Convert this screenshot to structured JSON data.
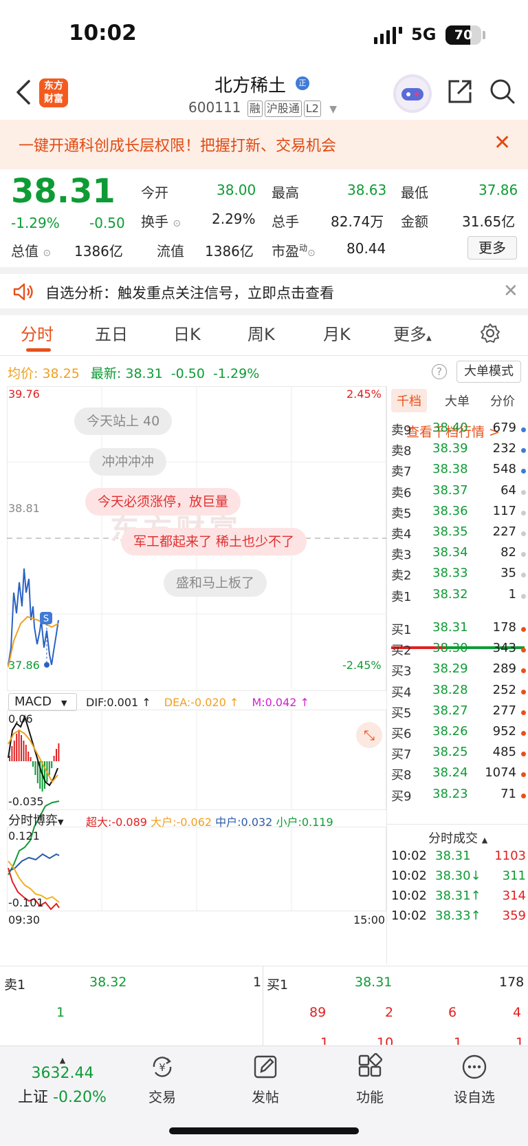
{
  "status": {
    "time": "10:02",
    "network": "5G",
    "battery": "70",
    "battery_level": 0.7
  },
  "header": {
    "logo": [
      "东方",
      "财富"
    ],
    "title": "北方稀土",
    "badge": "正",
    "code": "600111",
    "tags": [
      "融",
      "沪股通",
      "L2"
    ]
  },
  "banner": {
    "text": "一键开通科创成长层权限！把握打新、交易机会"
  },
  "quote": {
    "price": "38.31",
    "change_pct": "-1.29%",
    "change": "-0.50",
    "rows": [
      [
        {
          "label": "今开",
          "value": "38.00",
          "color": "g"
        },
        {
          "label": "最高",
          "value": "38.63",
          "color": "g"
        },
        {
          "label": "最低",
          "value": "37.86",
          "color": "g"
        }
      ],
      [
        {
          "label": "换手",
          "value": "2.29%",
          "color": ""
        },
        {
          "label": "总手",
          "value": "82.74万",
          "color": ""
        },
        {
          "label": "金额",
          "value": "31.65亿",
          "color": ""
        }
      ],
      [
        {
          "label": "流值",
          "value": "1386亿",
          "color": ""
        },
        {
          "label": "市盈",
          "value": "80.44",
          "color": ""
        }
      ]
    ],
    "total_label": "总值",
    "total_value": "1386亿",
    "pe_sup": "动",
    "more": "更多"
  },
  "alert": {
    "text": "自选分析：触发重点关注信号，立即点击查看"
  },
  "tabs": [
    "分时",
    "五日",
    "日K",
    "周K",
    "月K",
    "更多"
  ],
  "avg": {
    "avg_label": "均价:",
    "avg": "38.25",
    "latest_label": "最新:",
    "latest": "38.31",
    "chg": "-0.50",
    "pct": "-1.29%",
    "big_mode": "大单模式"
  },
  "chart": {
    "price_high": "39.76",
    "price_low": "37.86",
    "pct_high": "2.45%",
    "pct_low": "-2.45%",
    "ref": "38.81",
    "bubbles": [
      {
        "text": "今天站上 40",
        "style": "gray"
      },
      {
        "text": "冲冲冲冲",
        "style": "gray"
      },
      {
        "text": "今天必须涨停，放巨量",
        "style": "pink"
      },
      {
        "text": "军工都起来了 稀土也少不了",
        "style": "pink"
      },
      {
        "text": "盛和马上板了",
        "style": "gray"
      }
    ],
    "watermark": "东方财富",
    "macd": {
      "name": "MACD",
      "dif": "DIF:0.001 ↑",
      "dea": "DEA:-0.020 ↑",
      "m": "M:0.042 ↑",
      "top": "0.06",
      "bottom": "-0.035"
    },
    "game": {
      "name": "分时博弈",
      "super": "超大:-0.089",
      "big": "大户:-0.062",
      "mid": "中户:0.032",
      "small": "小户:0.119",
      "top": "0.121",
      "bottom": "-0.101"
    },
    "time_start": "09:30",
    "time_end": "15:00"
  },
  "book": {
    "tabs": [
      "千档",
      "大单",
      "分价"
    ],
    "link": "查看千档行情 >",
    "sells": [
      {
        "label": "卖9",
        "price": "38.40",
        "vol": "679",
        "dot": "#3f7ad8"
      },
      {
        "label": "卖8",
        "price": "38.39",
        "vol": "232",
        "dot": "#3f7ad8"
      },
      {
        "label": "卖7",
        "price": "38.38",
        "vol": "548",
        "dot": "#3f7ad8"
      },
      {
        "label": "卖6",
        "price": "38.37",
        "vol": "64",
        "dot": "#ccc"
      },
      {
        "label": "卖5",
        "price": "38.36",
        "vol": "117",
        "dot": "#ccc"
      },
      {
        "label": "卖4",
        "price": "38.35",
        "vol": "227",
        "dot": "#ccc"
      },
      {
        "label": "卖3",
        "price": "38.34",
        "vol": "82",
        "dot": "#ccc"
      },
      {
        "label": "卖2",
        "price": "38.33",
        "vol": "35",
        "dot": "#ccc"
      },
      {
        "label": "卖1",
        "price": "38.32",
        "vol": "1",
        "dot": "#ccc"
      }
    ],
    "buys": [
      {
        "label": "买1",
        "price": "38.31",
        "vol": "178",
        "dot": "#e8501a"
      },
      {
        "label": "买2",
        "price": "38.30",
        "vol": "343",
        "dot": "#e8501a"
      },
      {
        "label": "买3",
        "price": "38.29",
        "vol": "289",
        "dot": "#e8501a"
      },
      {
        "label": "买4",
        "price": "38.28",
        "vol": "252",
        "dot": "#e8501a"
      },
      {
        "label": "买5",
        "price": "38.27",
        "vol": "277",
        "dot": "#e8501a"
      },
      {
        "label": "买6",
        "price": "38.26",
        "vol": "952",
        "dot": "#e8501a"
      },
      {
        "label": "买7",
        "price": "38.25",
        "vol": "485",
        "dot": "#e8501a"
      },
      {
        "label": "买8",
        "price": "38.24",
        "vol": "1074",
        "dot": "#e8501a"
      },
      {
        "label": "买9",
        "price": "38.23",
        "vol": "71",
        "dot": "#e8501a"
      }
    ],
    "trades_title": "分时成交",
    "trades": [
      {
        "time": "10:02",
        "price": "38.31",
        "vol": "1103",
        "arrow": "",
        "color": "r"
      },
      {
        "time": "10:02",
        "price": "38.30↓",
        "vol": "311",
        "arrow": "",
        "color": "g"
      },
      {
        "time": "10:02",
        "price": "38.31↑",
        "vol": "314",
        "arrow": "",
        "color": "r"
      },
      {
        "time": "10:02",
        "price": "38.33↑",
        "vol": "359",
        "arrow": "",
        "color": "r"
      }
    ]
  },
  "bottom": {
    "sell_label": "卖1",
    "sell_price": "38.32",
    "sell_vol": "1",
    "buy_label": "买1",
    "buy_price": "38.31",
    "buy_vol": "178",
    "left_row": [
      "1"
    ],
    "right_row": [
      "89",
      "2",
      "6",
      "4"
    ],
    "right_row2": [
      "1",
      "10",
      "1",
      "1"
    ]
  },
  "nav": {
    "index_value": "3632.44",
    "index_name": "上证",
    "index_change": "-0.20%",
    "items": [
      "交易",
      "发帖",
      "功能",
      "设自选"
    ]
  }
}
